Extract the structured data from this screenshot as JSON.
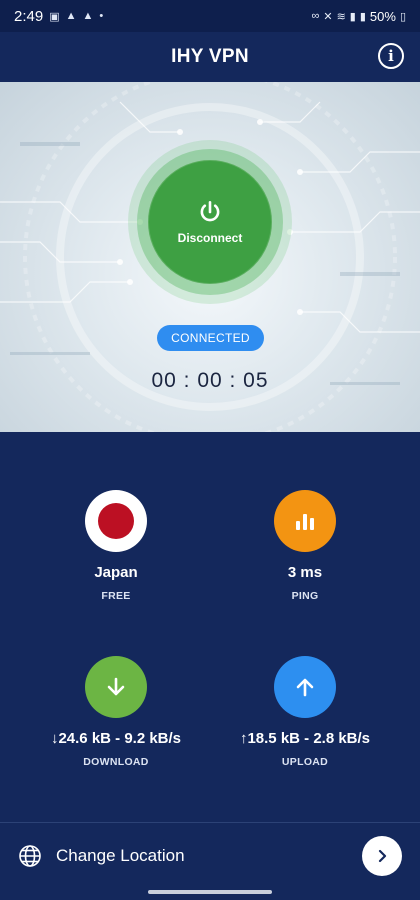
{
  "status_bar": {
    "time": "2:49",
    "left_icons": [
      "image-icon",
      "up-icon",
      "up-icon",
      "dot-icon"
    ],
    "battery": "50%"
  },
  "header": {
    "title": "IHY VPN",
    "info_icon": "info-icon"
  },
  "connection": {
    "button_label": "Disconnect",
    "status": "CONNECTED",
    "timer": "00 : 00 : 05",
    "button_color": "#3ea043"
  },
  "stats": {
    "location": {
      "value": "Japan",
      "label": "FREE",
      "icon": "japan-flag-icon"
    },
    "ping": {
      "value": "3 ms",
      "label": "PING",
      "icon": "signal-bars-icon",
      "color": "#f39412"
    },
    "download": {
      "value": "↓24.6 kB - 9.2 kB/s",
      "label": "DOWNLOAD",
      "icon": "download-arrow-icon",
      "color": "#6cb544"
    },
    "upload": {
      "value": "↑18.5 kB - 2.8 kB/s",
      "label": "UPLOAD",
      "icon": "upload-arrow-icon",
      "color": "#2d8ff0"
    }
  },
  "footer": {
    "change_location_label": "Change Location",
    "globe_icon": "globe-icon",
    "next_icon": "chevron-right-icon"
  }
}
